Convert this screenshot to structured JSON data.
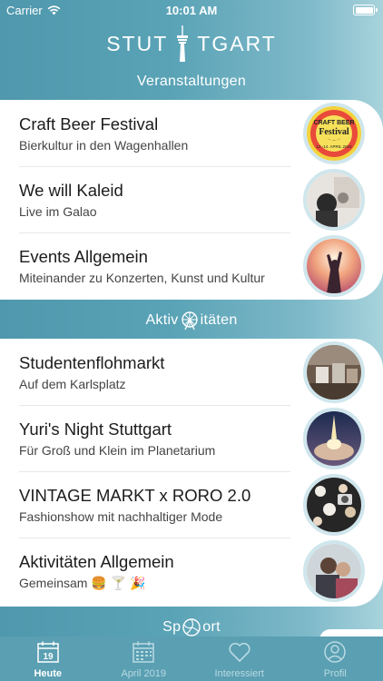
{
  "status_bar": {
    "carrier": "Carrier",
    "time": "10:01 AM"
  },
  "app": {
    "logo_left": "STUT",
    "logo_right": "TGART"
  },
  "sections": [
    {
      "label_left": "Veranstaltungen",
      "label_right": ""
    },
    {
      "label_left": "Aktiv",
      "label_right": "itäten"
    },
    {
      "label_left": "Sp",
      "label_right": "ort"
    }
  ],
  "events": [
    {
      "title": "Craft Beer Festival",
      "subtitle": "Bierkultur in den Wagenhallen"
    },
    {
      "title": "We will Kaleid",
      "subtitle": "Live im Galao"
    },
    {
      "title": "Events Allgemein",
      "subtitle": "Miteinander zu Konzerten, Kunst und Kultur"
    }
  ],
  "activities": [
    {
      "title": "Studentenflohmarkt",
      "subtitle": "Auf dem Karlsplatz"
    },
    {
      "title": "Yuri's Night Stuttgart",
      "subtitle": "Für Groß und Klein im Planetarium"
    },
    {
      "title": "VINTAGE MARKT x RORO 2.0",
      "subtitle": "Fashionshow mit nachhaltiger Mode"
    },
    {
      "title": "Aktivitäten Allgemein",
      "subtitle": "Gemeinsam 🍔 🍸 🎉"
    }
  ],
  "thumb_poster": {
    "line1": "CRAFT BEER",
    "line2": "Festival",
    "line3": "12.-14. APRIL 2019"
  },
  "tab_bar": {
    "tabs": [
      {
        "label": "Heute",
        "icon": "calendar-day-icon",
        "day": "19",
        "active": true
      },
      {
        "label": "April 2019",
        "icon": "calendar-month-icon",
        "active": false
      },
      {
        "label": "Interessiert",
        "icon": "heart-icon",
        "active": false
      },
      {
        "label": "Profil",
        "icon": "profile-icon",
        "active": false
      }
    ]
  },
  "colors": {
    "accent": "#5a9fb2",
    "thumb_border": "#cfe6ec",
    "tab_inactive": "#b9dbe3"
  }
}
